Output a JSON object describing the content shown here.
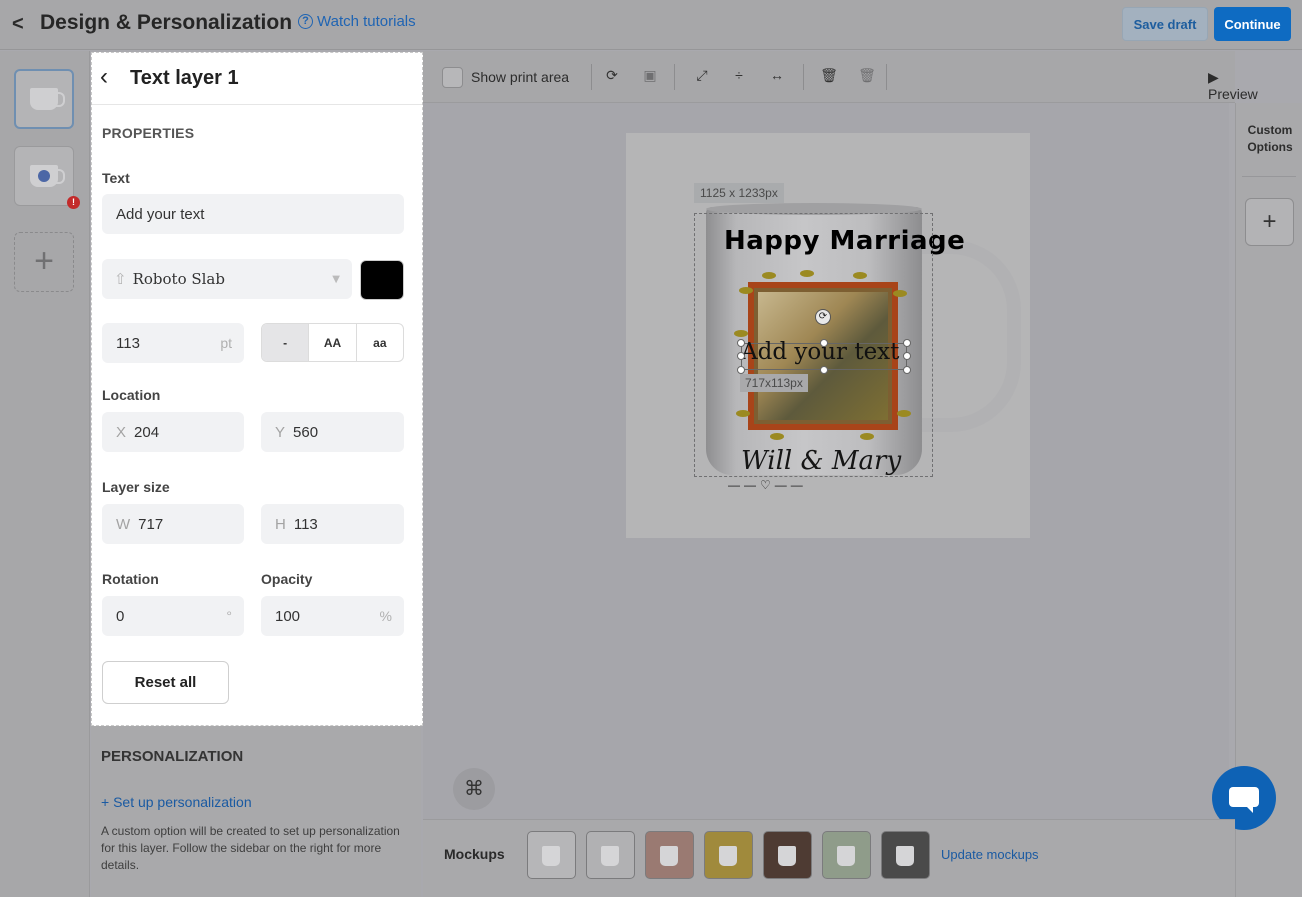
{
  "header": {
    "back_icon": "chevron-left-icon",
    "title": "Design & Personalization",
    "help_label": "Watch tutorials",
    "save_draft": "Save draft",
    "continue": "Continue"
  },
  "sidebar": {
    "add_icon": "plus-icon",
    "warning_badge": "!"
  },
  "panel": {
    "title": "Text layer 1",
    "properties_heading": "PROPERTIES",
    "text_label": "Text",
    "text_value": "Add your text",
    "font_name": "Roboto Slab",
    "font_color": "#000000",
    "size_value": "113",
    "size_unit": "pt",
    "case_options": [
      "-",
      "AA",
      "aa"
    ],
    "location_label": "Location",
    "x_prefix": "X",
    "x_value": "204",
    "y_prefix": "Y",
    "y_value": "560",
    "layer_size_label": "Layer size",
    "w_prefix": "W",
    "w_value": "717",
    "h_prefix": "H",
    "h_value": "113",
    "rotation_label": "Rotation",
    "rotation_value": "0",
    "rotation_unit": "°",
    "opacity_label": "Opacity",
    "opacity_value": "100",
    "opacity_unit": "%",
    "reset_label": "Reset all"
  },
  "personalization": {
    "heading": "PERSONALIZATION",
    "link": "+ Set up personalization",
    "description": "A custom option will be created to set up personalization for this layer. Follow the sidebar on the right for more details."
  },
  "toolbar": {
    "show_print_area": "Show print area",
    "preview": "Preview"
  },
  "canvas": {
    "print_area_size": "1125 x 1233px",
    "mug_heading": "Happy Marriage",
    "mug_script": "Will & Mary",
    "text_layer": "Add your text",
    "layer_size": "717x113px"
  },
  "right_panel": {
    "custom_options": "Custom Options"
  },
  "mockups": {
    "label": "Mockups",
    "update_link": "Update mockups",
    "thumb_colors": [
      "#b6b6b8",
      "#b1b1b3",
      "#9a7a72",
      "#a08a3c",
      "#4e3b33",
      "#8f9c8a",
      "#4a4a4a"
    ]
  }
}
